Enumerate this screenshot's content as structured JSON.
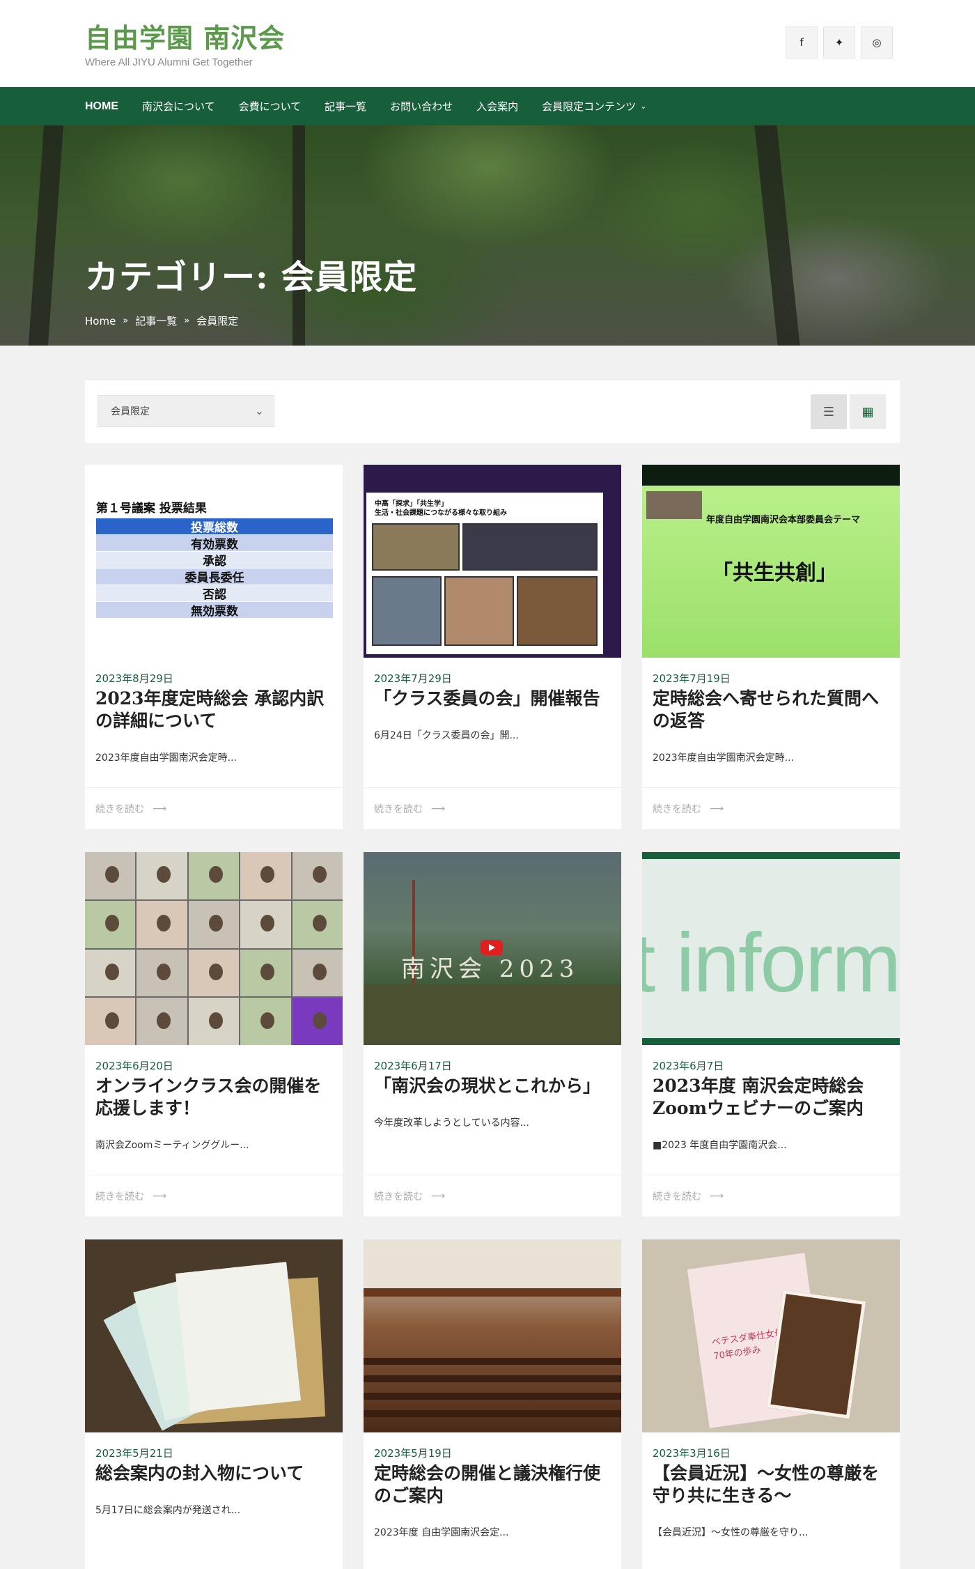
{
  "site": {
    "title": "自由学園 南沢会",
    "tagline": "Where All JIYU Alumni Get Together"
  },
  "social": [
    {
      "icon": "facebook-icon",
      "glyph": "f"
    },
    {
      "icon": "twitter-icon",
      "glyph": "🐦"
    },
    {
      "icon": "instagram-icon",
      "glyph": "◎"
    }
  ],
  "nav": {
    "items": [
      "HOME",
      "南沢会について",
      "会費について",
      "記事一覧",
      "お問い合わせ",
      "入会案内",
      "会員限定コンテンツ"
    ]
  },
  "hero": {
    "title": "カテゴリー: 会員限定",
    "breadcrumb": [
      "Home",
      "記事一覧",
      "会員限定"
    ]
  },
  "filter": {
    "selected": "会員限定"
  },
  "read_more": "続きを読む",
  "posts": [
    {
      "date": "2023年8月29日",
      "title": "2023年度定時総会 承認内訳の詳細について",
      "excerpt": "2023年度自由学園南沢会定時...",
      "thumb": {
        "heading": "第１号議案 投票結果",
        "rows": [
          "投票総数",
          "有効票数",
          "承認",
          "委員長委任",
          "否認",
          "無効票数"
        ]
      }
    },
    {
      "date": "2023年7月29日",
      "title": "「クラス委員の会」開催報告",
      "excerpt": "6月24日「クラス委員の会」開...",
      "thumb": {
        "text": "中高「探求」「共生学」\n生活・社会課題につながる様々な取り組み"
      }
    },
    {
      "date": "2023年7月19日",
      "title": "定時総会へ寄せられた質問への返答",
      "excerpt": "2023年度自由学園南沢会定時...",
      "thumb": {
        "theme": "年度自由学園南沢会本部委員会テーマ",
        "big": "「共生共創」"
      }
    },
    {
      "date": "2023年6月20日",
      "title": "オンラインクラス会の開催を応援します！",
      "excerpt": "南沢会Zoomミーティンググルー..."
    },
    {
      "date": "2023年6月17日",
      "title": "「南沢会の現状とこれから」",
      "excerpt": "今年度改革しようとしている内容...",
      "thumb": {
        "text": "南沢会 2023"
      }
    },
    {
      "date": "2023年6月7日",
      "title": "2023年度 南沢会定時総会Zoomウェビナーのご案内",
      "excerpt": "■2023 年度自由学園南沢会...",
      "thumb": {
        "text": "t inform"
      }
    },
    {
      "date": "2023年5月21日",
      "title": "総会案内の封入物について",
      "excerpt": "5月17日に総会案内が発送され..."
    },
    {
      "date": "2023年5月19日",
      "title": "定時総会の開催と議決権行使のご案内",
      "excerpt": "2023年度 自由学園南沢会定..."
    },
    {
      "date": "2023年3月16日",
      "title": "【会員近況】～女性の尊厳を守り共に生きる～",
      "excerpt": "【会員近況】～女性の尊厳を守り...",
      "thumb": {
        "text": "ベテスダ奉仕女母の家\n70年の歩み"
      }
    }
  ]
}
